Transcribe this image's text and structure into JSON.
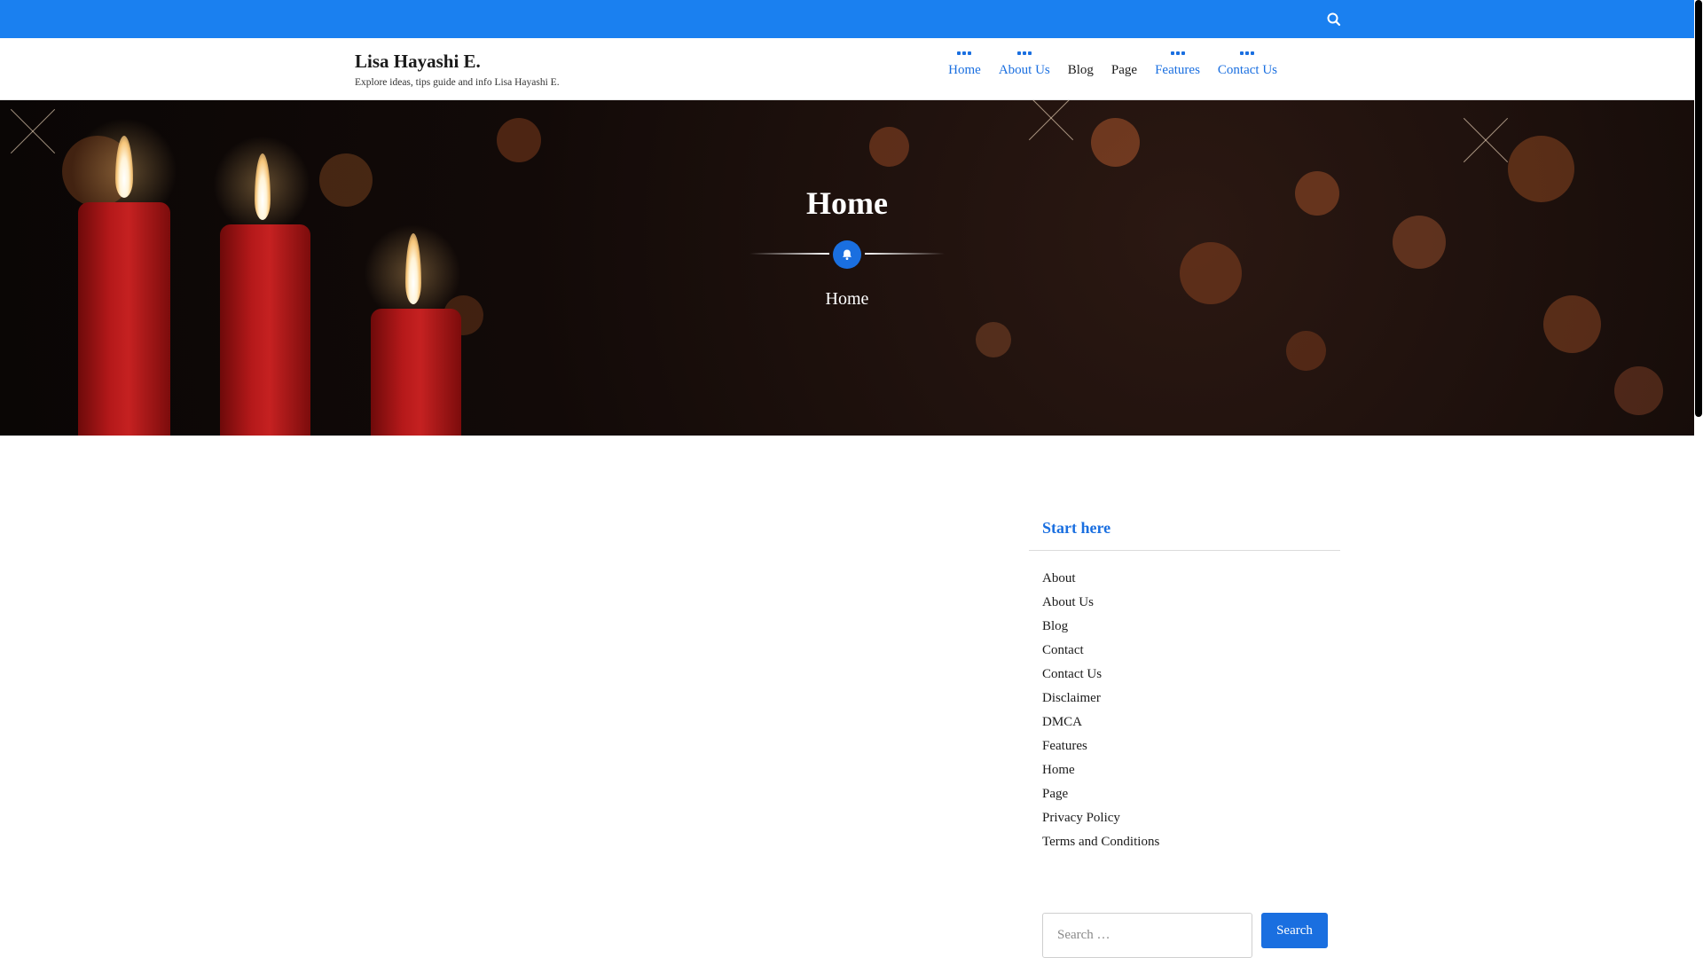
{
  "colors": {
    "accent": "#1a6fe0",
    "topbar": "#1a80f0",
    "text": "#1a1a1a"
  },
  "topbar": {
    "search_icon": "search-icon"
  },
  "header": {
    "site_title": "Lisa Hayashi E.",
    "tagline": "Explore ideas, tips guide and info Lisa Hayashi E."
  },
  "nav": {
    "items": [
      {
        "label": "Home",
        "has_submenu": true
      },
      {
        "label": "About Us",
        "has_submenu": true
      },
      {
        "label": "Blog",
        "has_submenu": false
      },
      {
        "label": "Page",
        "has_submenu": false
      },
      {
        "label": "Features",
        "has_submenu": true
      },
      {
        "label": "Contact Us",
        "has_submenu": true
      }
    ]
  },
  "hero": {
    "title": "Home",
    "subtitle": "Home",
    "divider_icon": "bell-icon"
  },
  "sidebar": {
    "widget_title": "Start here",
    "pages": [
      "About",
      "About Us",
      "Blog",
      "Contact",
      "Contact Us",
      "Disclaimer",
      "DMCA",
      "Features",
      "Home",
      "Page",
      "Privacy Policy",
      "Terms and Conditions"
    ],
    "search": {
      "placeholder": "Search …",
      "button_label": "Search"
    }
  }
}
